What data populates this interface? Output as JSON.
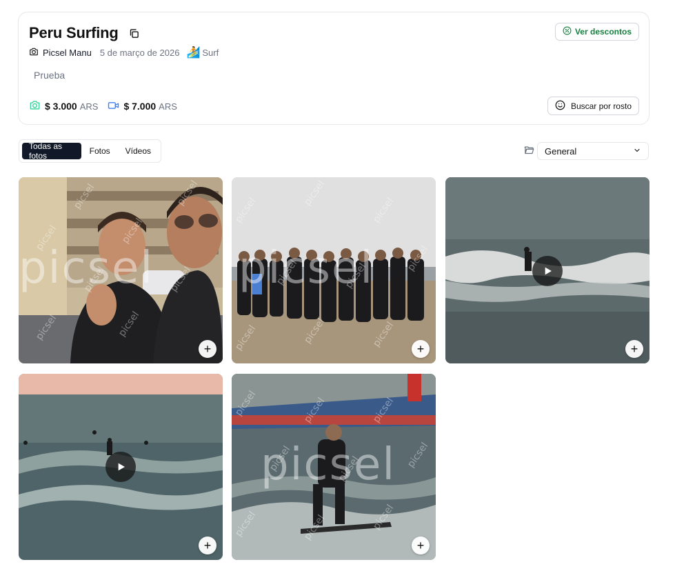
{
  "event": {
    "title": "Peru Surfing",
    "author": "Picsel Manu",
    "date": "5 de março de 2026",
    "sport": "Surf",
    "description": "Prueba"
  },
  "actions": {
    "discounts_label": "Ver descontos",
    "face_search_label": "Buscar por rosto"
  },
  "prices": {
    "photo_amount": "$ 3.000",
    "photo_currency": "ARS",
    "video_amount": "$ 7.000",
    "video_currency": "ARS"
  },
  "tabs": [
    {
      "label": "Todas as fotos",
      "active": true
    },
    {
      "label": "Fotos",
      "active": false
    },
    {
      "label": "Vídeos",
      "active": false
    }
  ],
  "folder_select": {
    "value": "General"
  },
  "watermark": "picsel",
  "colors": {
    "accent_green": "#15803d",
    "price_icon_green": "#34d399",
    "price_icon_blue": "#3b82f6",
    "active_tab": "#111827"
  },
  "media": [
    {
      "type": "photo",
      "scene": "selfie-two-men"
    },
    {
      "type": "photo",
      "scene": "group-on-beach"
    },
    {
      "type": "video",
      "scene": "surfer-riding-wave"
    },
    {
      "type": "video",
      "scene": "surfers-in-sea"
    },
    {
      "type": "photo",
      "scene": "surfer-standing-board"
    }
  ]
}
